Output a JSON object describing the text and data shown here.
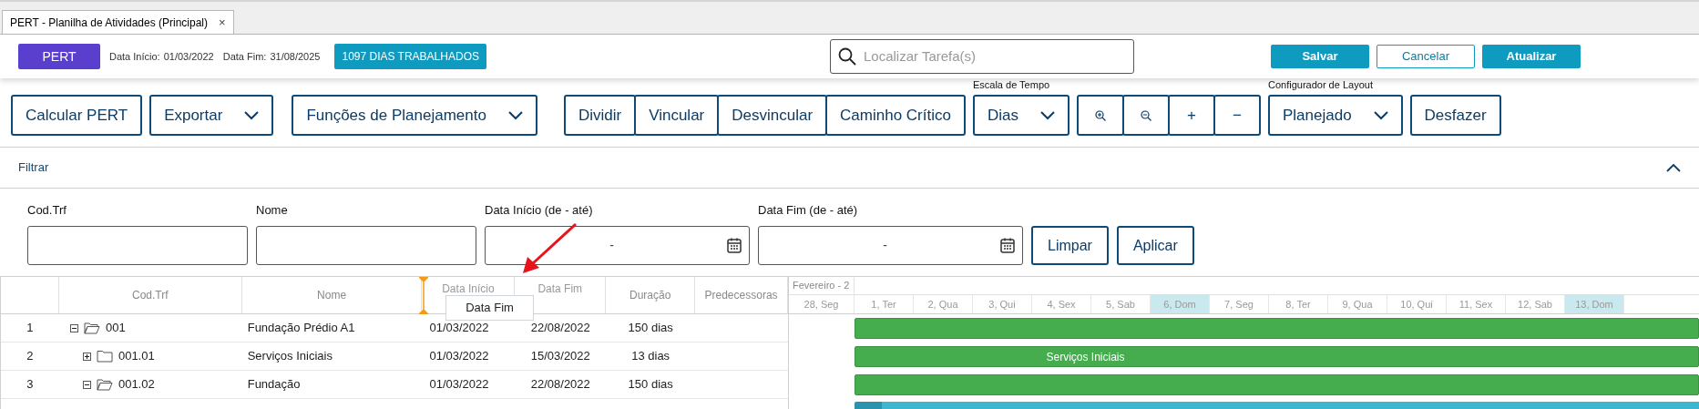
{
  "tab": {
    "label": "PERT - Planilha de Atividades (Principal)",
    "close": "×",
    "selected": true
  },
  "header": {
    "badge": "PERT",
    "start_label": "Data Início:",
    "start": "01/03/2022",
    "end_label": "Data Fim:",
    "end": "31/08/2025",
    "days": "1097 DIAS TRABALHADOS",
    "search": {
      "placeholder": "Localizar Tarefa(s)"
    },
    "buttons": [
      {
        "label": "Salvar",
        "kind": "primary"
      },
      {
        "label": "Cancelar",
        "kind": "outline"
      },
      {
        "label": "Atualizar",
        "kind": "primary"
      }
    ]
  },
  "toolbar": [
    {
      "kind": "button",
      "label": "Calcular PERT"
    },
    {
      "kind": "dropdown",
      "label": "Exportar"
    },
    {
      "kind": "dropdown",
      "label": "Funções de Planejamento"
    },
    {
      "kind": "group",
      "buttons": [
        "Dividir",
        "Vincular",
        "Desvincular",
        "Caminho Crítico"
      ]
    },
    {
      "kind": "dropdown",
      "caption": "Escala de Tempo",
      "label": "Dias"
    },
    {
      "kind": "zoom",
      "buttons": [
        "+",
        "−"
      ]
    },
    {
      "kind": "dropdown",
      "caption": "Configurador de Layout",
      "label": "Planejado"
    },
    {
      "kind": "button",
      "label": "Desfazer"
    }
  ],
  "filter": {
    "title": "Filtrar",
    "expanded": true,
    "fields": [
      {
        "label": "Cod.Trf",
        "kind": "text"
      },
      {
        "label": "Nome",
        "kind": "text"
      },
      {
        "label": "Data Início (de - até)",
        "kind": "date",
        "value": "-"
      },
      {
        "label": "Data Fim (de - até)",
        "kind": "date",
        "value": "-"
      }
    ],
    "buttons": [
      "Limpar",
      "Aplicar"
    ]
  },
  "grid": {
    "columns": [
      "Cod.Trf",
      "Nome",
      "Data Início",
      "Data Fim",
      "Duração",
      "Predecessoras"
    ],
    "drag_ghost": "Data Fim",
    "rows": [
      {
        "num": "1",
        "code": "001",
        "name": "Fundação Prédio A1",
        "start": "01/03/2022",
        "end": "22/08/2022",
        "duration": "150 dias",
        "expanded": true,
        "children": [
          {
            "num": "2",
            "code": "001.01",
            "name": "Serviços Iniciais",
            "start": "01/03/2022",
            "end": "15/03/2022",
            "duration": "13 dias",
            "expanded": false,
            "bar": "Serviços Iniciais"
          },
          {
            "num": "3",
            "code": "001.02",
            "name": "Fundação",
            "start": "01/03/2022",
            "end": "22/08/2022",
            "duration": "150 dias",
            "expanded": true
          }
        ]
      }
    ]
  },
  "timeline": {
    "month": "Fevereiro - 2",
    "days": [
      {
        "label": "28, Seg",
        "weekend": false
      },
      {
        "label": "1, Ter",
        "weekend": false
      },
      {
        "label": "2, Qua",
        "weekend": false
      },
      {
        "label": "3, Qui",
        "weekend": false
      },
      {
        "label": "4, Sex",
        "weekend": false
      },
      {
        "label": "5, Sab",
        "weekend": false
      },
      {
        "label": "6, Dom",
        "weekend": true
      },
      {
        "label": "7, Seg",
        "weekend": false
      },
      {
        "label": "8, Ter",
        "weekend": false
      },
      {
        "label": "9, Qua",
        "weekend": false
      },
      {
        "label": "10, Qui",
        "weekend": false
      },
      {
        "label": "11, Sex",
        "weekend": false
      },
      {
        "label": "12, Sab",
        "weekend": false
      },
      {
        "label": "13, Dom",
        "weekend": true
      }
    ]
  }
}
